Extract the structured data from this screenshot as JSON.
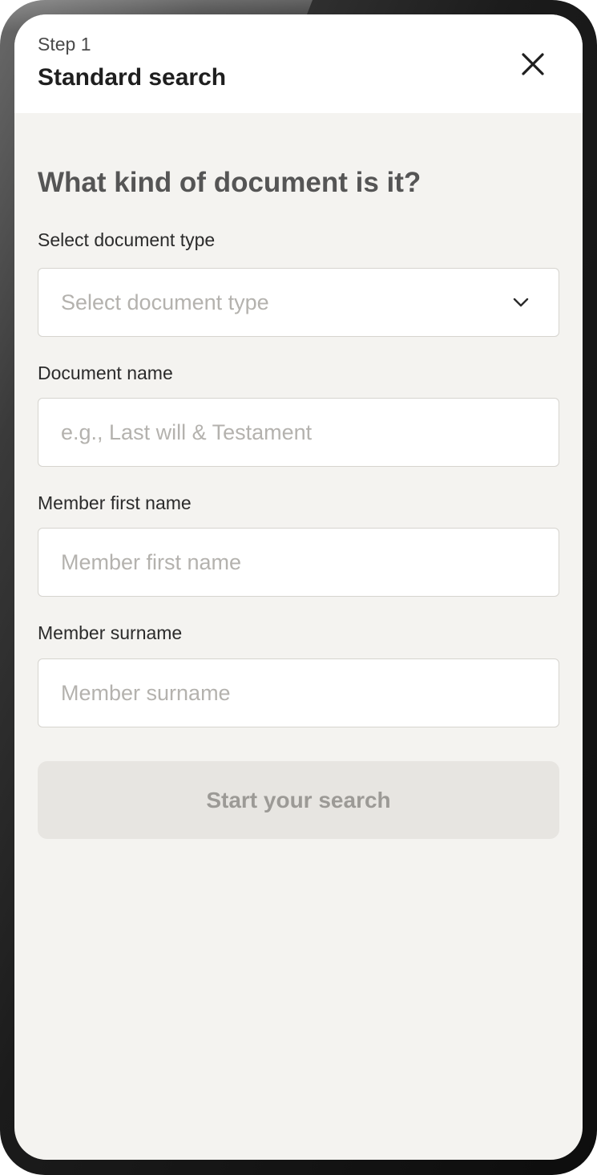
{
  "header": {
    "step": "Step 1",
    "title": "Standard search",
    "close_icon": "close-icon"
  },
  "form": {
    "question": "What kind of document is it?",
    "document_type": {
      "label": "Select document type",
      "placeholder": "Select document type",
      "icon": "chevron-down-icon"
    },
    "document_name": {
      "label": "Document name",
      "placeholder": "e.g., Last will & Testament"
    },
    "first_name": {
      "label": "Member first name",
      "placeholder": "Member first name"
    },
    "surname": {
      "label": "Member surname",
      "placeholder": "Member surname"
    },
    "submit_label": "Start your search"
  },
  "colors": {
    "background": "#f4f3f0",
    "header": "#ffffff",
    "button_disabled": "#e7e5e1",
    "button_text_disabled": "#9c9a96",
    "placeholder": "#b4b2ae"
  }
}
